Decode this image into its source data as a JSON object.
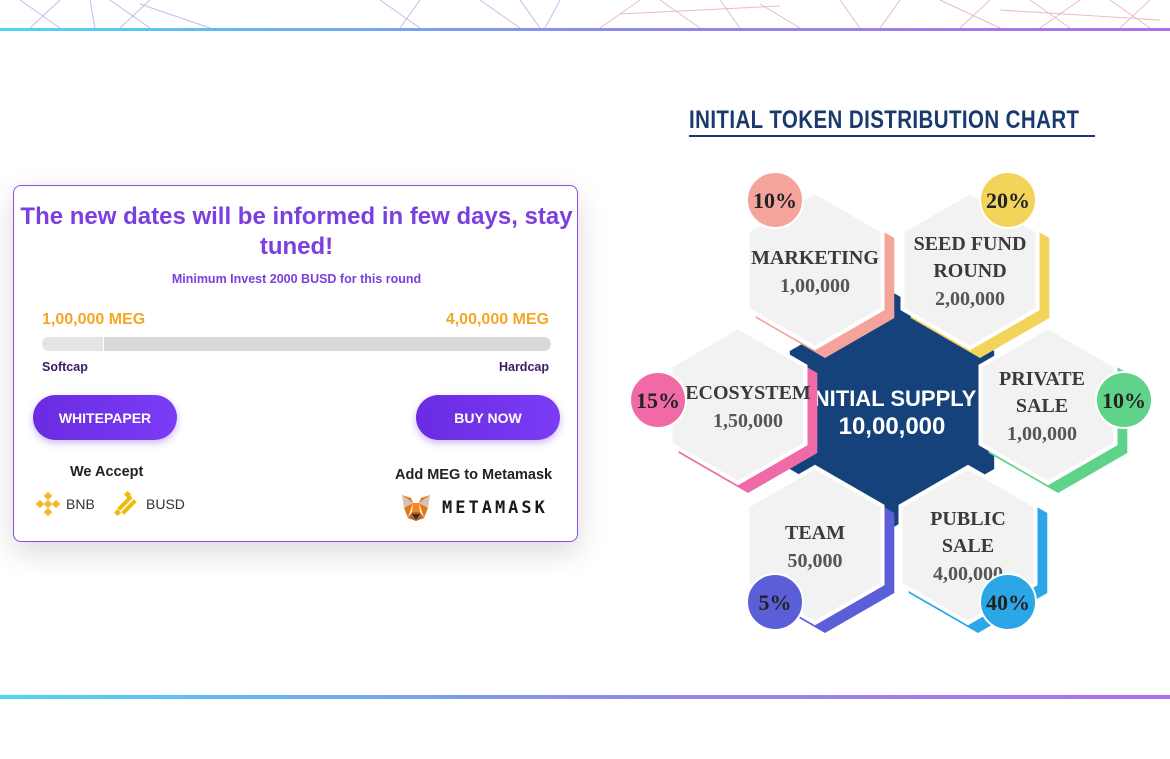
{
  "card": {
    "headline": "The new dates will be informed in few days, stay tuned!",
    "subline": "Minimum Invest 2000 BUSD for this round",
    "softcap_amount": "1,00,000 MEG",
    "hardcap_amount": "4,00,000 MEG",
    "softcap_label": "Softcap",
    "hardcap_label": "Hardcap",
    "progress_fraction": 0.12,
    "whitepaper_label": "WHITEPAPER",
    "buy_label": "BUY NOW",
    "accept_title": "We Accept",
    "coins": [
      "BNB",
      "BUSD"
    ],
    "metamask_title": "Add MEG to Metamask",
    "metamask_text": "METAMASK"
  },
  "chart": {
    "title": "INITIAL TOKEN DISTRIBUTION CHART",
    "center_title": "INITIAL SUPPLY",
    "center_value": "10,00,000"
  },
  "chart_data": {
    "type": "pie",
    "title": "INITIAL TOKEN DISTRIBUTION CHART",
    "total": "10,00,000",
    "slices": [
      {
        "name": "MARKETING",
        "value": "1,00,000",
        "percent": "10%",
        "color": "#f4a49a"
      },
      {
        "name": "SEED FUND ROUND",
        "value": "2,00,000",
        "percent": "20%",
        "color": "#f3d45a"
      },
      {
        "name": "PRIVATE SALE",
        "value": "1,00,000",
        "percent": "10%",
        "color": "#5fd38a"
      },
      {
        "name": "PUBLIC SALE",
        "value": "4,00,000",
        "percent": "40%",
        "color": "#2ba7e8"
      },
      {
        "name": "TEAM",
        "value": "50,000",
        "percent": "5%",
        "color": "#5a5fd8"
      },
      {
        "name": "ECOSYSTEM",
        "value": "1,50,000",
        "percent": "15%",
        "color": "#f06aa8"
      }
    ]
  },
  "colors": {
    "accent": "#7b3fe0",
    "cap_amount": "#f5a623",
    "chart_center": "#15427a"
  }
}
